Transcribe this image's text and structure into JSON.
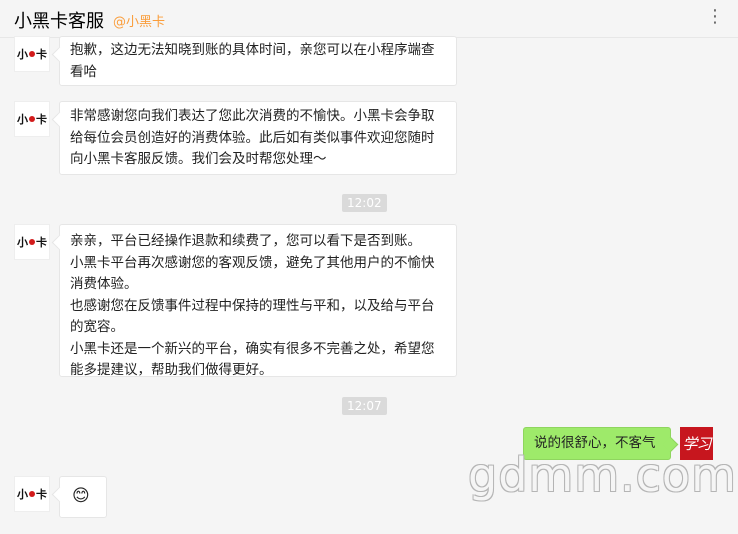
{
  "header": {
    "title": "小黑卡客服",
    "handle": "@小黑卡",
    "more_icon": "more-dots-icon"
  },
  "contact": {
    "avatar_text_left": "小",
    "avatar_text_right": "卡"
  },
  "messages": [
    {
      "from": "other",
      "text": "抱歉，这边无法知晓到账的具体时间，亲您可以在小程序端查\n看哈"
    },
    {
      "from": "other",
      "text": "非常感谢您向我们表达了您此次消费的不愉快。小黑卡会争取\n给每位会员创造好的消费体验。此后如有类似事件欢迎您随时\n向小黑卡客服反馈。我们会及时帮您处理～"
    },
    {
      "from": "other",
      "text": "亲亲，平台已经操作退款和续费了，您可以看下是否到账。\n小黑卡平台再次感谢您的客观反馈，避免了其他用户的不愉快\n消费体验。\n也感谢您在反馈事件过程中保持的理性与平和，以及给与平台\n的宽容。\n小黑卡还是一个新兴的平台，确实有很多不完善之处，希望您\n能多提建议，帮助我们做得更好。"
    },
    {
      "from": "me",
      "text": "说的很舒心，不客气"
    },
    {
      "from": "other",
      "text": "😊"
    }
  ],
  "timestamps": [
    "12:02",
    "12:07"
  ],
  "me": {
    "avatar_text": "学习"
  },
  "watermark": "gdmm.com"
}
